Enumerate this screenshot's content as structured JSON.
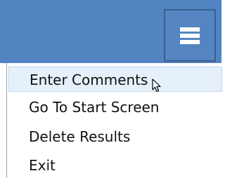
{
  "header": {
    "menu_button_icon": "hamburger-menu-icon",
    "colors": {
      "header_bg": "#5284c1",
      "button_border": "#3a5f8c",
      "highlight_bg": "#e5f0fb"
    }
  },
  "menu": {
    "items": [
      {
        "label": "Enter Comments",
        "highlighted": true
      },
      {
        "label": "Go To Start Screen",
        "highlighted": false
      },
      {
        "label": "Delete Results",
        "highlighted": false
      },
      {
        "label": "Exit",
        "highlighted": false
      }
    ]
  },
  "cursor": {
    "icon": "pointer-cursor-icon"
  }
}
